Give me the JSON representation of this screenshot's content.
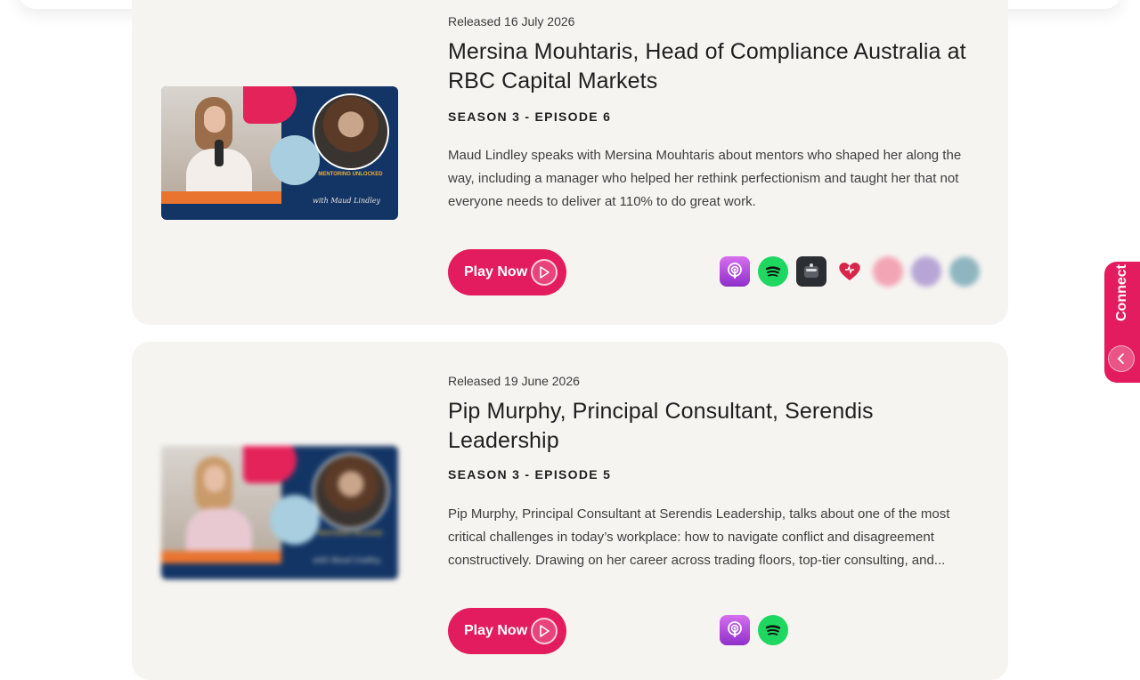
{
  "episodes": [
    {
      "released": "Released 16 July 2026",
      "title": "Mersina Mouhtaris, Head of Compliance Australia at RBC Capital Markets",
      "episode": "SEASON 3 - EPISODE 6",
      "description": "Maud Lindley speaks with Mersina Mouhtaris about mentors who shaped her along the way, including a manager who helped her rethink perfectionism and taught her that not everyone needs to deliver at 110% to do great work.",
      "play_label": "Play Now",
      "thumbnail": {
        "tagline": "MENTORING UNLOCKED",
        "signature": "with Maud Lindley"
      },
      "platforms": [
        "apple-podcasts-icon",
        "spotify-icon",
        "pocket-casts-icon",
        "iheart-icon",
        "castbox-icon",
        "podbean-icon",
        "podcast-app-icon"
      ]
    },
    {
      "released": "Released 19 June 2026",
      "title": "Pip Murphy, Principal Consultant, Serendis Leadership",
      "episode": "SEASON 3 - EPISODE 5",
      "description": "Pip Murphy, Principal Consultant at Serendis Leadership, talks about one of the most critical challenges in today’s workplace: how to navigate conflict and disagreement constructively. Drawing on her career across trading floors, top-tier consulting, and...",
      "play_label": "Play Now",
      "thumbnail": {
        "tagline": "MENTORING UNLOCKED",
        "signature": "with Maud Lindley"
      },
      "platforms": [
        "apple-podcasts-icon",
        "spotify-icon"
      ]
    }
  ],
  "connect": {
    "label": "Connect"
  },
  "colors": {
    "accent": "#e31c5f",
    "card_background": "#f6f4f1",
    "spotify": "#1ed760",
    "apple_podcasts": "#a94fd9"
  }
}
